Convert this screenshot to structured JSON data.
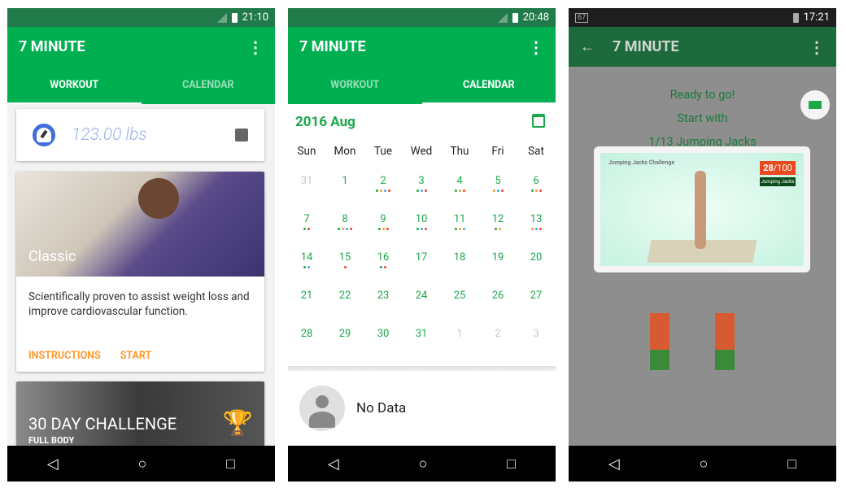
{
  "colors": {
    "primary": "#00b050",
    "status_bar": "#217a4a",
    "accent_orange": "#ff9a2e",
    "dot_green": "#1aa84a",
    "dot_orange": "#ff9a2e",
    "dot_blue": "#42a5f5",
    "dot_red": "#f44336"
  },
  "screen1": {
    "time": "21:10",
    "title": "7 MINUTE",
    "tabs": [
      "WORKOUT",
      "CALENDAR"
    ],
    "weight": "123.00 lbs",
    "classic": {
      "title": "Classic",
      "description": "Scientifically proven to assist weight loss and improve cardiovascular function.",
      "instructions": "INSTRUCTIONS",
      "start": "START"
    },
    "challenge": {
      "title": "30 DAY CHALLENGE",
      "subtitle": "FULL BODY"
    }
  },
  "screen2": {
    "time": "20:48",
    "title": "7 MINUTE",
    "tabs": [
      "WORKOUT",
      "CALENDAR"
    ],
    "month": "2016 Aug",
    "weekdays": [
      "Sun",
      "Mon",
      "Tue",
      "Wed",
      "Thu",
      "Fri",
      "Sat"
    ],
    "days": [
      {
        "d": "31",
        "dim": true,
        "dots": ""
      },
      {
        "d": "1",
        "dots": ""
      },
      {
        "d": "2",
        "dots": "gobr"
      },
      {
        "d": "3",
        "dots": "gbr"
      },
      {
        "d": "4",
        "dots": "gor"
      },
      {
        "d": "5",
        "dots": "obr"
      },
      {
        "d": "6",
        "dots": "gor"
      },
      {
        "d": "7",
        "dots": "gr"
      },
      {
        "d": "8",
        "dots": "gobr"
      },
      {
        "d": "9",
        "dots": "gor"
      },
      {
        "d": "10",
        "dots": "gbr"
      },
      {
        "d": "11",
        "dots": "gob"
      },
      {
        "d": "12",
        "dots": "go"
      },
      {
        "d": "13",
        "dots": "obr"
      },
      {
        "d": "14",
        "dots": "gb"
      },
      {
        "d": "15",
        "dots": "r"
      },
      {
        "d": "16",
        "dots": "gr",
        "selected": true
      },
      {
        "d": "17",
        "dots": ""
      },
      {
        "d": "18",
        "dots": ""
      },
      {
        "d": "19",
        "dots": ""
      },
      {
        "d": "20",
        "dots": ""
      },
      {
        "d": "21",
        "dots": ""
      },
      {
        "d": "22",
        "dots": ""
      },
      {
        "d": "23",
        "dots": ""
      },
      {
        "d": "24",
        "dots": ""
      },
      {
        "d": "25",
        "dots": ""
      },
      {
        "d": "26",
        "dots": ""
      },
      {
        "d": "27",
        "dots": ""
      },
      {
        "d": "28",
        "dots": ""
      },
      {
        "d": "29",
        "dots": ""
      },
      {
        "d": "30",
        "dots": ""
      },
      {
        "d": "31",
        "dots": ""
      },
      {
        "d": "1",
        "dim": true,
        "dots": ""
      },
      {
        "d": "2",
        "dim": true,
        "dots": ""
      },
      {
        "d": "3",
        "dim": true,
        "dots": ""
      }
    ],
    "no_data": "No Data"
  },
  "screen3": {
    "time": "17:21",
    "title": "7 MINUTE",
    "ready": "Ready to go!",
    "start_with": "Start with",
    "exercise": "1/13 Jumping Jacks",
    "video": {
      "caption": "Jumping Jacks Challenge",
      "count": "28",
      "total": "/100",
      "label": "Jumping Jacks"
    }
  }
}
